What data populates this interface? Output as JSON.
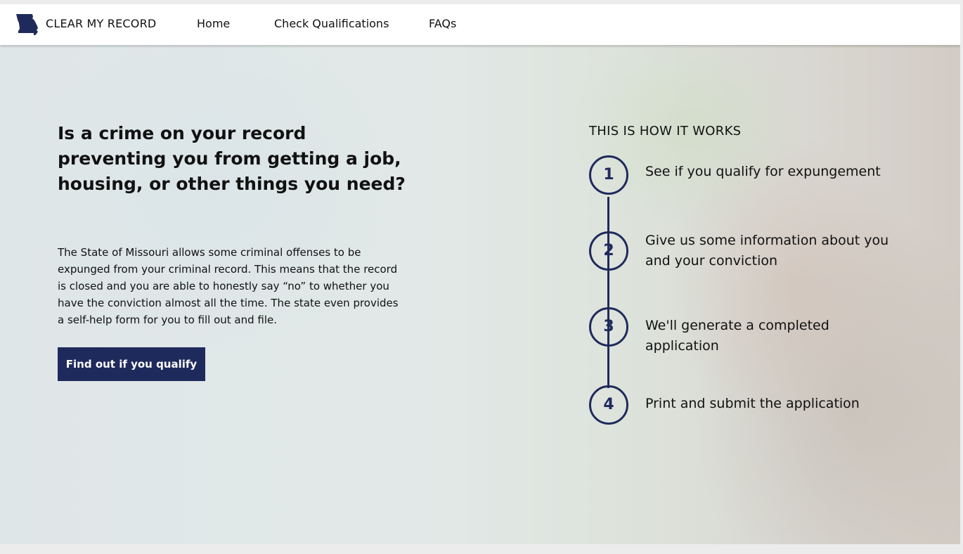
{
  "header": {
    "brand": "CLEAR MY RECORD",
    "nav": [
      {
        "label": "Home"
      },
      {
        "label": "Check Qualifications"
      },
      {
        "label": "FAQs"
      }
    ]
  },
  "hero": {
    "headline": "Is a crime on your record preventing you from getting a job, housing, or other things you need?",
    "intro": "The State of Missouri allows some criminal offenses to be expunged from your criminal record. This means that the record is closed and you are able to honestly say “no” to whether you have the conviction almost all the time. The state even provides a self-help form for you to fill out and file.",
    "cta_label": "Find out if you qualify"
  },
  "how_it_works": {
    "title": "THIS IS HOW IT WORKS",
    "steps": [
      {
        "number": "1",
        "text": "See if you qualify for expungement"
      },
      {
        "number": "2",
        "text": "Give us some information about you and your conviction"
      },
      {
        "number": "3",
        "text": "We'll generate a completed application"
      },
      {
        "number": "4",
        "text": "Print and submit the application"
      }
    ]
  },
  "colors": {
    "accent": "#1f2a5c",
    "header_bg": "#ffffff"
  },
  "icons": {
    "logo": "missouri-state-icon"
  }
}
